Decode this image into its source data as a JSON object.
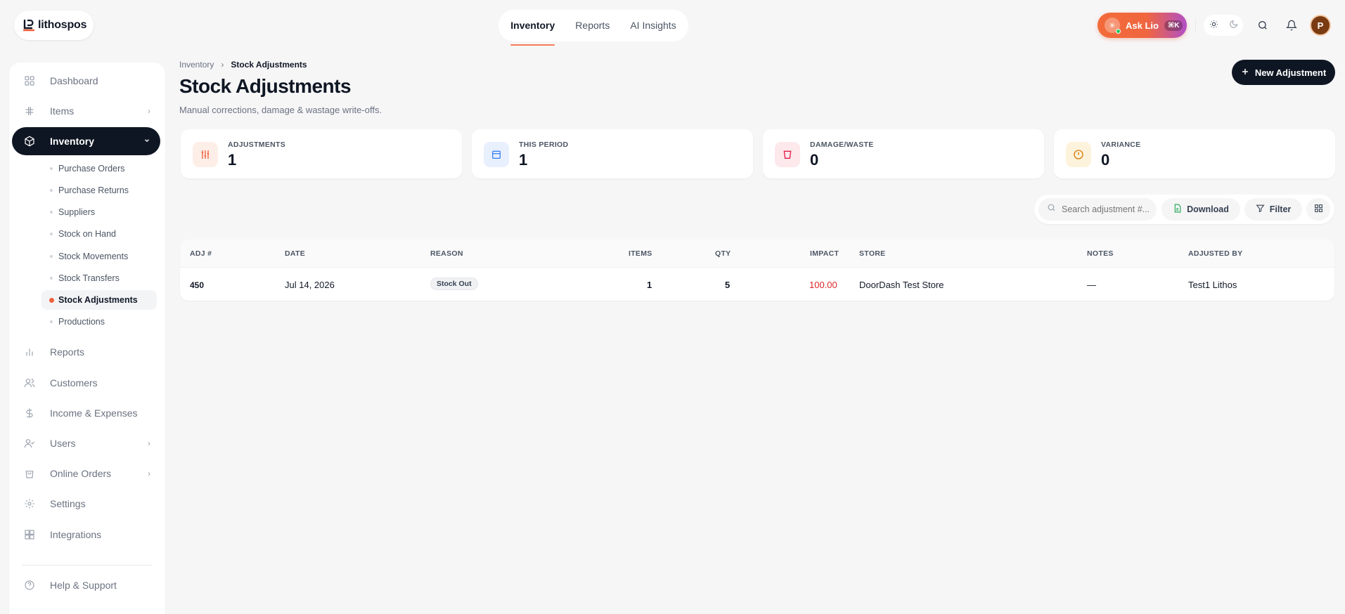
{
  "app": {
    "logo_text": "lithospos"
  },
  "topnav": {
    "tabs": [
      "Inventory",
      "Reports",
      "AI Insights"
    ],
    "active": "Inventory"
  },
  "topright": {
    "ask_label": "Ask Lio",
    "ask_kbd": "⌘K",
    "avatar_letter": "P"
  },
  "sidebar": {
    "items": [
      {
        "label": "Dashboard",
        "icon": "grid-icon"
      },
      {
        "label": "Items",
        "icon": "hash-icon"
      },
      {
        "label": "Inventory",
        "icon": "box-icon"
      },
      {
        "label": "Reports",
        "icon": "bar-chart-icon"
      },
      {
        "label": "Customers",
        "icon": "users-icon"
      },
      {
        "label": "Income & Expenses",
        "icon": "dollar-icon"
      },
      {
        "label": "Users",
        "icon": "user-check-icon"
      },
      {
        "label": "Online Orders",
        "icon": "shopping-bag-icon"
      },
      {
        "label": "Settings",
        "icon": "gear-icon"
      },
      {
        "label": "Integrations",
        "icon": "integrations-icon"
      },
      {
        "label": "Help & Support",
        "icon": "help-icon"
      }
    ],
    "inventory_sub": [
      "Purchase Orders",
      "Purchase Returns",
      "Suppliers",
      "Stock on Hand",
      "Stock Movements",
      "Stock Transfers",
      "Stock Adjustments",
      "Productions"
    ],
    "active_sub": "Stock Adjustments"
  },
  "breadcrumb": {
    "parent": "Inventory",
    "separator": "›",
    "current": "Stock Adjustments"
  },
  "page": {
    "title": "Stock Adjustments",
    "subtitle": "Manual corrections, damage & wastage write-offs.",
    "new_button": "New Adjustment"
  },
  "stats": [
    {
      "label": "ADJUSTMENTS",
      "value": "1",
      "color": "#f0603a"
    },
    {
      "label": "THIS PERIOD",
      "value": "1",
      "color": "#3b82f6"
    },
    {
      "label": "DAMAGE/WASTE",
      "value": "0",
      "color": "#e11d48"
    },
    {
      "label": "VARIANCE",
      "value": "0",
      "color": "#d97706"
    }
  ],
  "toolbar": {
    "search_placeholder": "Search adjustment #...",
    "download": "Download",
    "filter": "Filter"
  },
  "table": {
    "headers": [
      "ADJ #",
      "DATE",
      "REASON",
      "ITEMS",
      "QTY",
      "IMPACT",
      "STORE",
      "NOTES",
      "ADJUSTED BY"
    ],
    "rows": [
      {
        "adj": "450",
        "date": "Jul 14, 2026",
        "reason": "Stock Out",
        "items": "1",
        "qty": "5",
        "impact": "100.00",
        "store": "DoorDash Test Store",
        "notes": "—",
        "adjusted_by": "Test1 Lithos"
      }
    ]
  },
  "colors": {
    "accent": "#f0603a",
    "dark": "#0f1623",
    "impact_negative": "#dc2626"
  }
}
